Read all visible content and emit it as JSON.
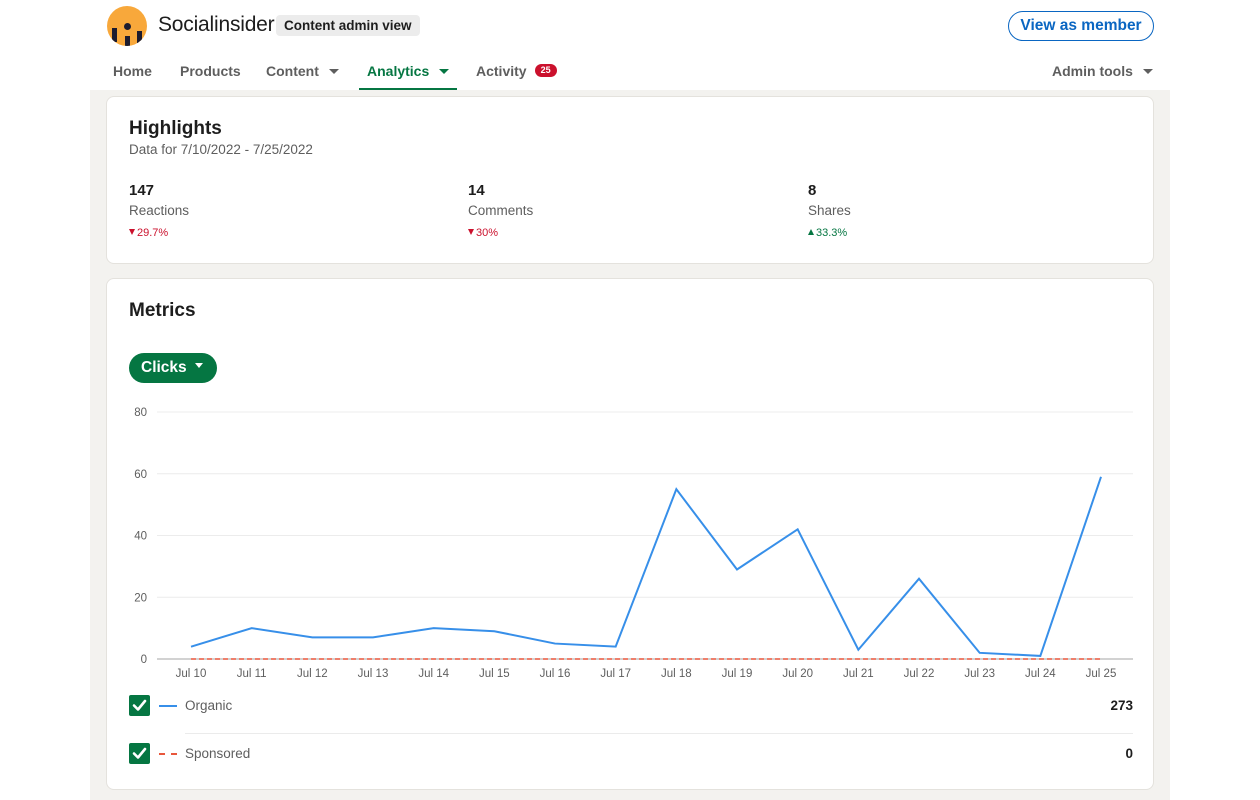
{
  "header": {
    "brand_name": "Socialinsider",
    "view_badge": "Content admin view",
    "view_as_member": "View as member"
  },
  "nav": {
    "items": [
      {
        "label": "Home",
        "dropdown": false,
        "active": false
      },
      {
        "label": "Products",
        "dropdown": false,
        "active": false
      },
      {
        "label": "Content",
        "dropdown": true,
        "active": false
      },
      {
        "label": "Analytics",
        "dropdown": true,
        "active": true
      },
      {
        "label": "Activity",
        "dropdown": false,
        "active": false,
        "badge": "25"
      }
    ],
    "admin_tools": "Admin tools"
  },
  "highlights": {
    "title": "Highlights",
    "subtitle": "Data for 7/10/2022 - 7/25/2022",
    "stats": [
      {
        "value": "147",
        "label": "Reactions",
        "change": "29.7%",
        "direction": "down"
      },
      {
        "value": "14",
        "label": "Comments",
        "change": "30%",
        "direction": "down"
      },
      {
        "value": "8",
        "label": "Shares",
        "change": "33.3%",
        "direction": "up"
      }
    ]
  },
  "metrics": {
    "title": "Metrics",
    "metric_selector": "Clicks",
    "legend": [
      {
        "name": "Organic",
        "total": "273",
        "checked": true,
        "color": "#378fe9",
        "style": "solid"
      },
      {
        "name": "Sponsored",
        "total": "0",
        "checked": true,
        "color": "#e8573c",
        "style": "dashed"
      }
    ]
  },
  "chart_data": {
    "type": "line",
    "title": "Clicks",
    "xlabel": "",
    "ylabel": "",
    "x": [
      "Jul 10",
      "Jul 11",
      "Jul 12",
      "Jul 13",
      "Jul 14",
      "Jul 15",
      "Jul 16",
      "Jul 17",
      "Jul 18",
      "Jul 19",
      "Jul 20",
      "Jul 21",
      "Jul 22",
      "Jul 23",
      "Jul 24",
      "Jul 25"
    ],
    "series": [
      {
        "name": "Organic",
        "values": [
          4,
          10,
          7,
          7,
          10,
          9,
          5,
          4,
          55,
          29,
          42,
          3,
          26,
          2,
          1,
          59
        ],
        "color": "#378fe9",
        "style": "solid"
      },
      {
        "name": "Sponsored",
        "values": [
          0,
          0,
          0,
          0,
          0,
          0,
          0,
          0,
          0,
          0,
          0,
          0,
          0,
          0,
          0,
          0
        ],
        "color": "#e8573c",
        "style": "dashed"
      }
    ],
    "ylim": [
      0,
      80
    ],
    "yticks": [
      0,
      20,
      40,
      60,
      80
    ],
    "grid": true,
    "legend_position": "bottom"
  }
}
